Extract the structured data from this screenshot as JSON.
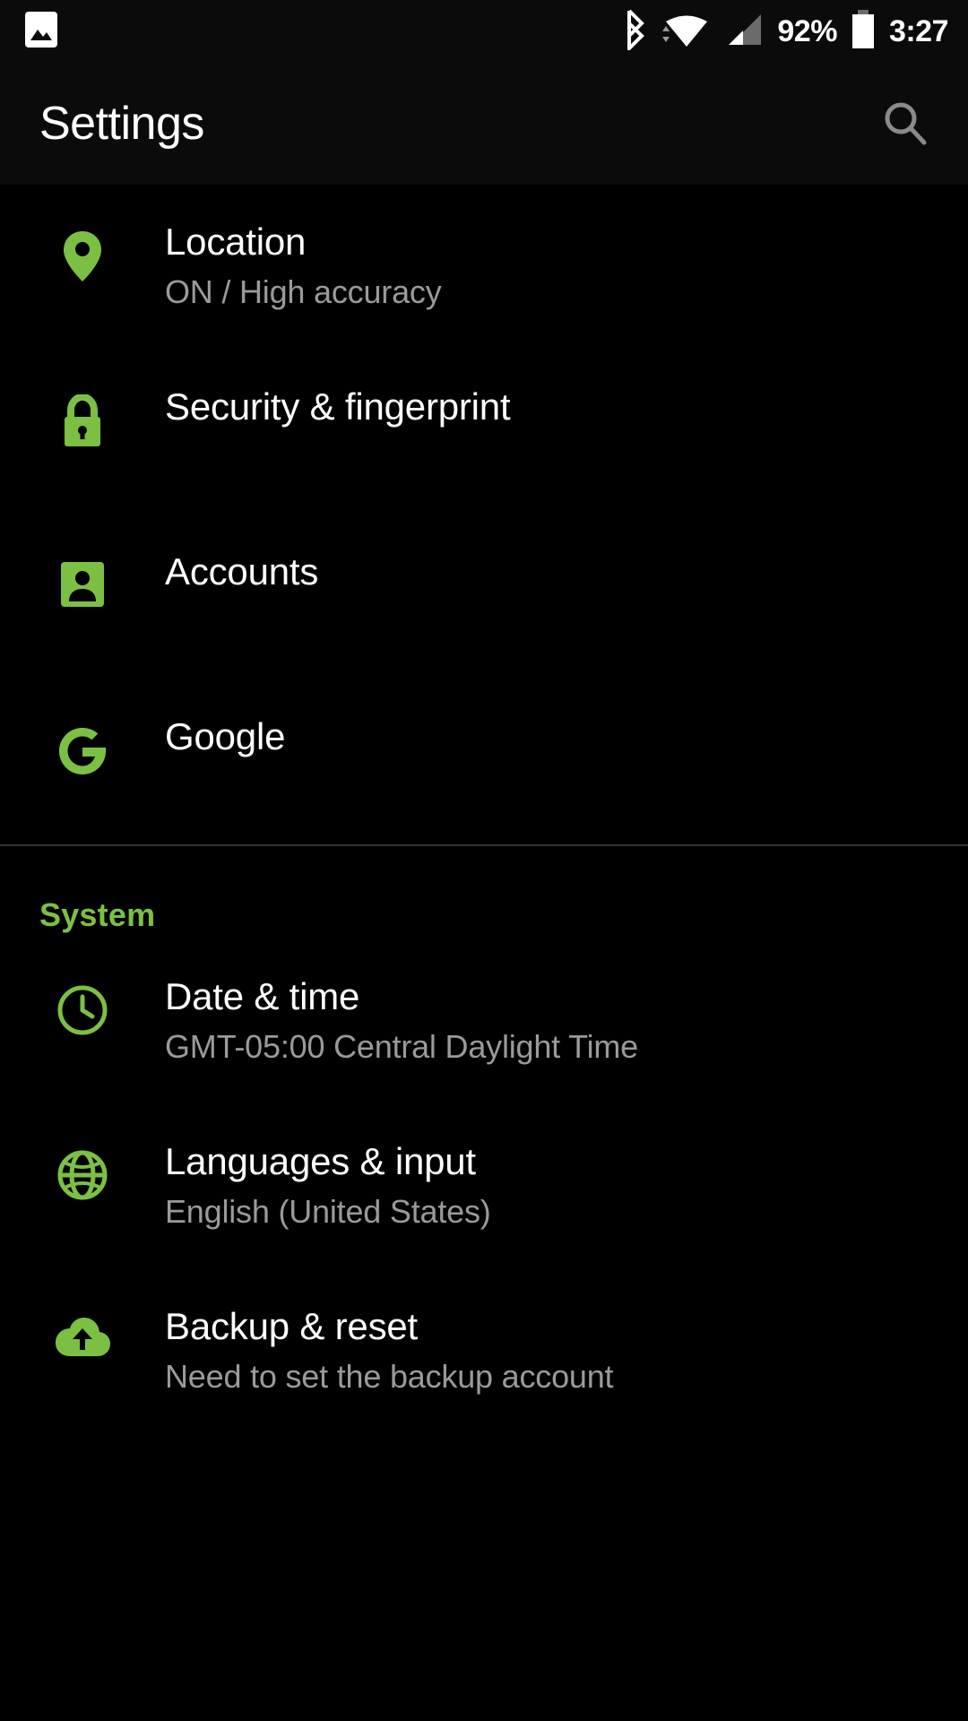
{
  "status_bar": {
    "left_icons": [
      {
        "name": "image-icon",
        "glyph": "image"
      }
    ],
    "right_icons": [
      {
        "name": "bluetooth-icon",
        "glyph": "bluetooth"
      },
      {
        "name": "wifi-icon",
        "glyph": "wifi"
      },
      {
        "name": "cellular-signal-icon",
        "glyph": "signal"
      }
    ],
    "battery_percent": "92%",
    "battery_icon_name": "battery-full-icon",
    "clock": "3:27"
  },
  "app_bar": {
    "title": "Settings",
    "search_icon_name": "search-icon"
  },
  "colors": {
    "accent_green": "#7cc043",
    "background": "#000000",
    "bar_background": "#0b0b0b",
    "primary_text": "#ffffff",
    "secondary_text": "#9a9a9a",
    "divider": "#333333"
  },
  "list": {
    "items": [
      {
        "id": "location",
        "icon": "location-pin-icon",
        "title": "Location",
        "subtitle": "ON / High accuracy"
      },
      {
        "id": "security-fingerprint",
        "icon": "lock-icon",
        "title": "Security & fingerprint",
        "subtitle": ""
      },
      {
        "id": "accounts",
        "icon": "account-person-icon",
        "title": "Accounts",
        "subtitle": ""
      },
      {
        "id": "google",
        "icon": "google-g-icon",
        "title": "Google",
        "subtitle": ""
      }
    ]
  },
  "system_section": {
    "header": "System",
    "items": [
      {
        "id": "date-time",
        "icon": "clock-icon",
        "title": "Date & time",
        "subtitle": "GMT-05:00 Central Daylight Time"
      },
      {
        "id": "languages-input",
        "icon": "globe-icon",
        "title": "Languages & input",
        "subtitle": "English (United States)"
      },
      {
        "id": "backup-reset",
        "icon": "cloud-upload-icon",
        "title": "Backup & reset",
        "subtitle": "Need to set the backup account"
      }
    ]
  }
}
